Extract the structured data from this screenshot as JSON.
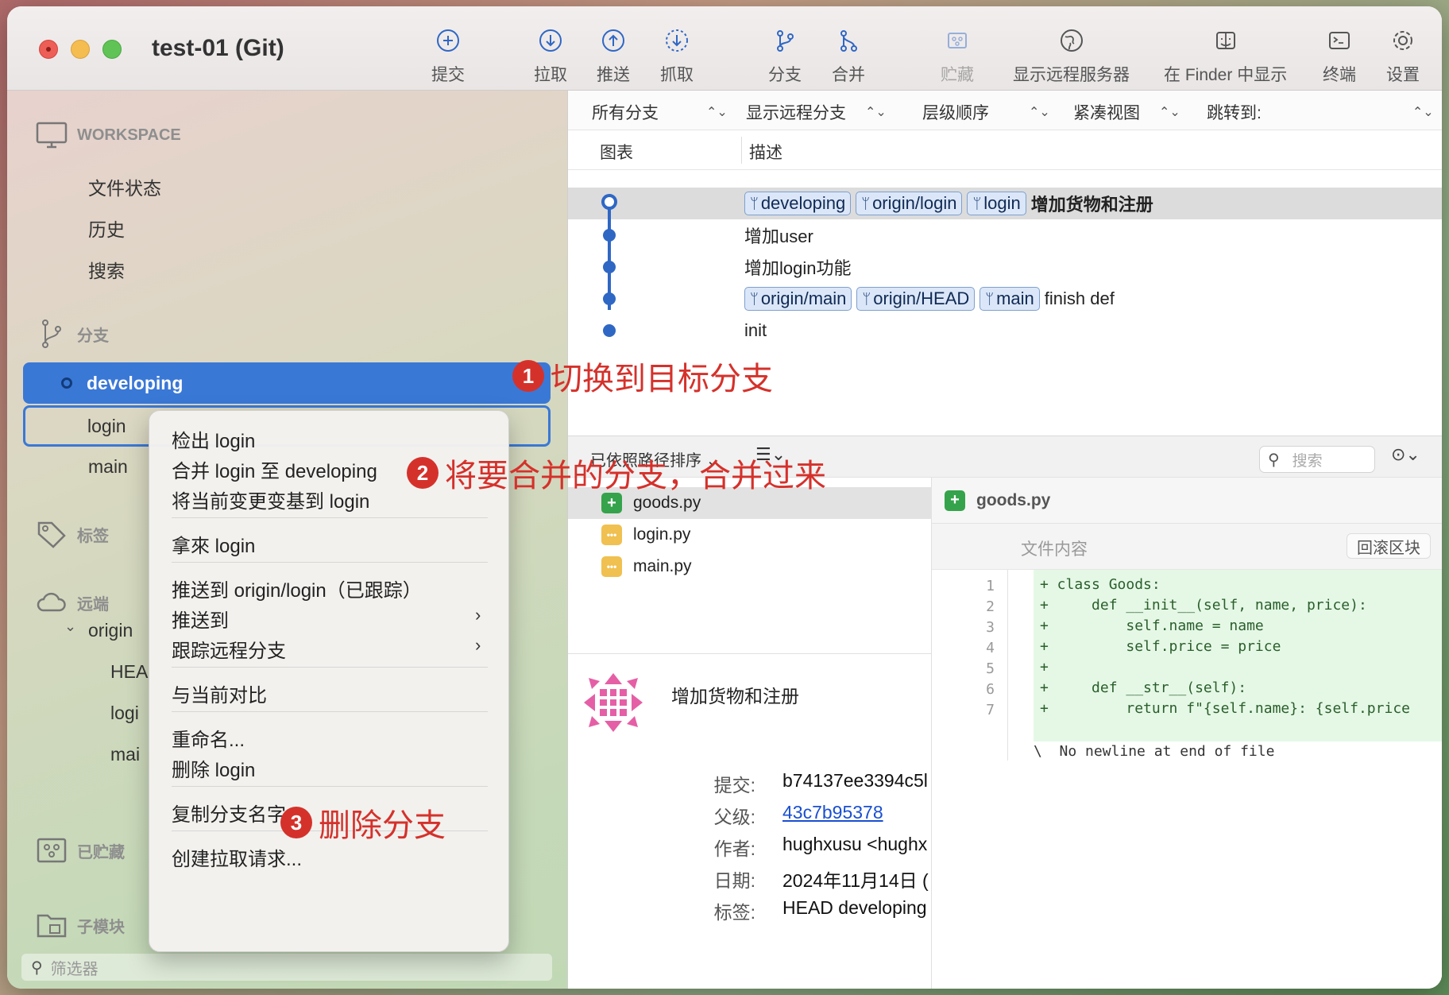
{
  "window": {
    "title": "test-01 (Git)"
  },
  "toolbar": {
    "items": [
      {
        "label": "提交",
        "icon": "plus-circle-icon"
      },
      {
        "label": "拉取",
        "icon": "arrow-down-circle-icon"
      },
      {
        "label": "推送",
        "icon": "arrow-up-circle-icon"
      },
      {
        "label": "抓取",
        "icon": "dashed-arrow-down-circle-icon"
      },
      {
        "label": "分支",
        "icon": "branch-icon"
      },
      {
        "label": "合并",
        "icon": "merge-icon"
      },
      {
        "label": "贮藏",
        "icon": "stash-icon"
      },
      {
        "label": "显示远程服务器",
        "icon": "globe-icon"
      },
      {
        "label": "在 Finder 中显示",
        "icon": "finder-icon"
      },
      {
        "label": "终端",
        "icon": "terminal-icon"
      },
      {
        "label": "设置",
        "icon": "gear-icon"
      }
    ]
  },
  "sidebar": {
    "workspace": "WORKSPACE",
    "workspace_items": [
      "文件状态",
      "历史",
      "搜索"
    ],
    "branches_header": "分支",
    "branches": [
      "developing",
      "login",
      "main"
    ],
    "tags_header": "标签",
    "remotes_header": "远端",
    "remote_origin": "origin",
    "remote_items": [
      "HEA",
      "logi",
      "mai"
    ],
    "stashes_header": "已贮藏",
    "submodules_header": "子模块",
    "filter_placeholder": "筛选器"
  },
  "filterbar": {
    "all_branches": "所有分支",
    "show_remote": "显示远程分支",
    "order": "层级顺序",
    "view": "紧凑视图",
    "jump": "跳转到:"
  },
  "columns": {
    "graph": "图表",
    "desc": "描述"
  },
  "commits": [
    {
      "tags": [
        "developing",
        "origin/login",
        "login"
      ],
      "message": "增加货物和注册"
    },
    {
      "tags": [],
      "message": "增加user"
    },
    {
      "tags": [],
      "message": "增加login功能"
    },
    {
      "tags": [
        "origin/main",
        "origin/HEAD",
        "main"
      ],
      "message": "finish def"
    },
    {
      "tags": [],
      "message": "init"
    }
  ],
  "lower": {
    "sort": "已依照路径排序 ⌄",
    "search_placeholder": "搜索",
    "files": [
      {
        "name": "goods.py",
        "status": "added"
      },
      {
        "name": "login.py",
        "status": "modified"
      },
      {
        "name": "main.py",
        "status": "modified"
      }
    ]
  },
  "commit_detail": {
    "title": "增加货物和注册",
    "rows": [
      {
        "k": "提交:",
        "v": "b74137ee3394c5l"
      },
      {
        "k": "父级:",
        "v": "43c7b95378"
      },
      {
        "k": "作者:",
        "v": "hughxusu <hughx"
      },
      {
        "k": "日期:",
        "v": "2024年11月14日 ("
      },
      {
        "k": "标签:",
        "v": "HEAD developing"
      }
    ]
  },
  "diff": {
    "file": "goods.py",
    "sublabel": "文件内容",
    "rollback": "回滚区块",
    "lines": [
      "+ class Goods:",
      "+     def __init__(self, name, price):",
      "+         self.name = name",
      "+         self.price = price",
      "+",
      "+     def __str__(self):",
      "+         return f\"{self.name}: {self.price"
    ],
    "no_newline": "\\  No newline at end of file"
  },
  "context_menu": {
    "items": [
      "检出 login",
      "合并 login 至 developing",
      "将当前变更变基到 login",
      "拿來 login",
      "推送到 origin/login（已跟踪）",
      "推送到",
      "跟踪远程分支",
      "与当前对比",
      "重命名...",
      "删除 login",
      "复制分支名字",
      "创建拉取请求..."
    ]
  },
  "annotations": [
    {
      "num": "1",
      "text": "切换到目标分支"
    },
    {
      "num": "2",
      "text": "将要合并的分支，合并过来"
    },
    {
      "num": "3",
      "text": "删除分支"
    }
  ],
  "colors": {
    "accent": "#3a78d6",
    "annotation": "#d5312b",
    "graph": "#2f67c4"
  }
}
